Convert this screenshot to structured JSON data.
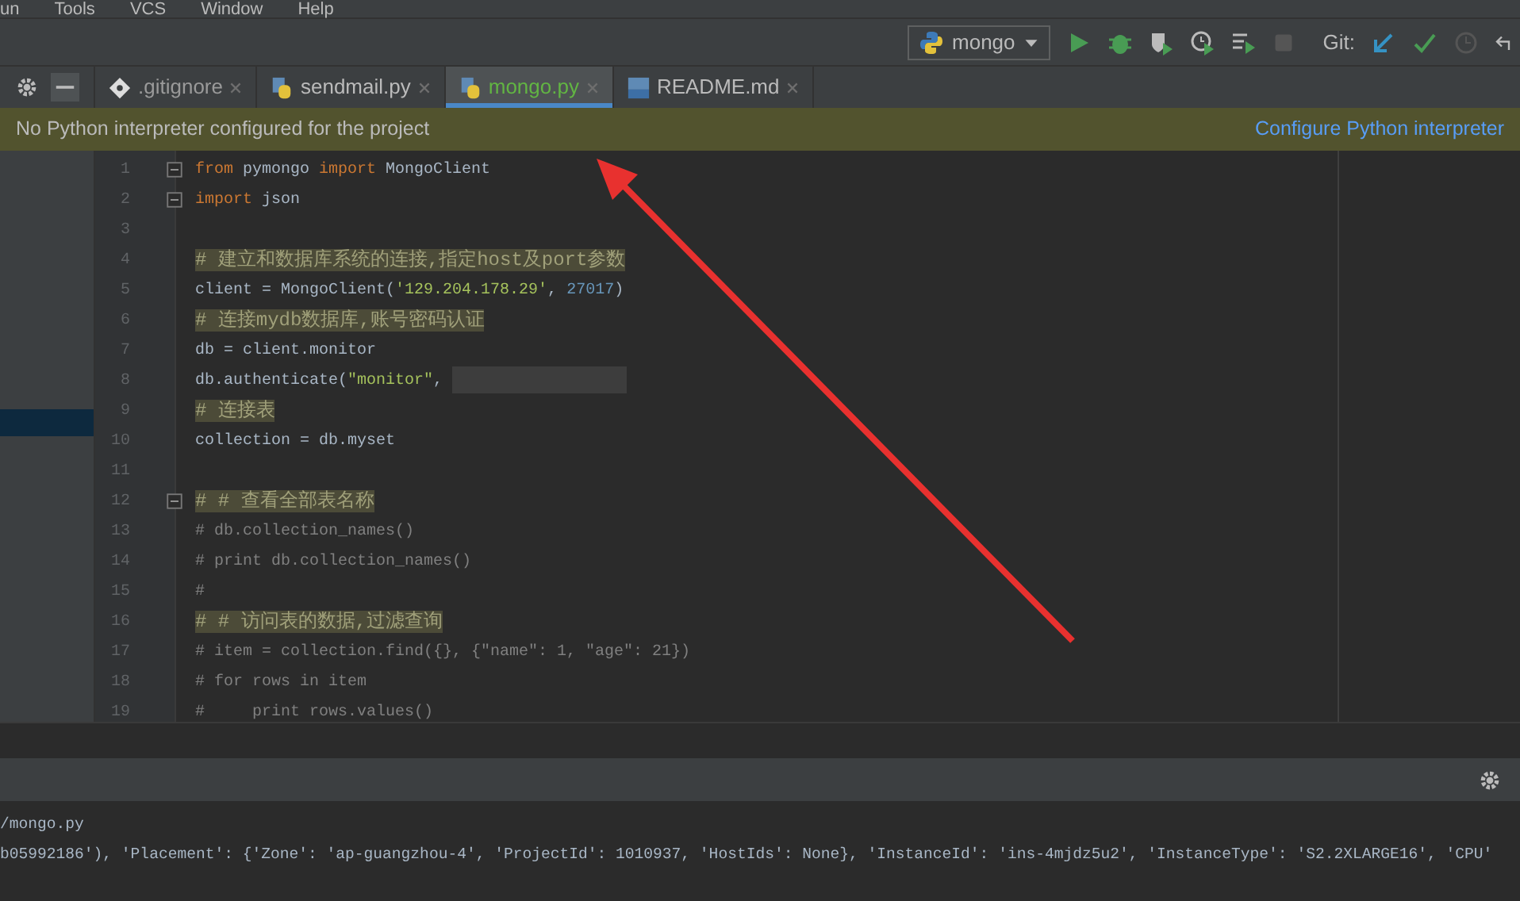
{
  "menu": [
    "un",
    "Tools",
    "VCS",
    "Window",
    "Help"
  ],
  "toolbar": {
    "run_config": "mongo",
    "stop_disabled": true,
    "git_label": "Git:"
  },
  "tabs": [
    {
      "label": ".gitignore",
      "kind": "git",
      "selected": false,
      "color": "#9a9a9a"
    },
    {
      "label": "sendmail.py",
      "kind": "python",
      "selected": false,
      "color": "#bbbbbb"
    },
    {
      "label": "mongo.py",
      "kind": "python",
      "selected": true,
      "color": "#62b543"
    },
    {
      "label": "README.md",
      "kind": "markdown",
      "selected": false,
      "color": "#bbbbbb"
    }
  ],
  "banner": {
    "message": "No Python interpreter configured for the project",
    "link": "Configure Python interpreter"
  },
  "editor": {
    "lines": [
      {
        "number": "1",
        "fold": true,
        "tokens": [
          {
            "kind": "keyword",
            "text": "from"
          },
          {
            "kind": "text",
            "text": " pymongo "
          },
          {
            "kind": "keyword",
            "text": "import"
          },
          {
            "kind": "text",
            "text": " MongoClient"
          }
        ]
      },
      {
        "number": "2",
        "fold": true,
        "tokens": [
          {
            "kind": "keyword",
            "text": "import"
          },
          {
            "kind": "text",
            "text": " json"
          }
        ]
      },
      {
        "number": "3",
        "fold": false
      },
      {
        "number": "4",
        "fold": false,
        "tokens": [
          {
            "kind": "note",
            "text": "# 建立和数据库系统的连接,指定host及port参数"
          }
        ]
      },
      {
        "number": "5",
        "fold": false,
        "tokens": [
          {
            "kind": "text",
            "text": "client = MongoClient("
          },
          {
            "kind": "string",
            "text": "'129.204.178.29'"
          },
          {
            "kind": "text",
            "text": ", "
          },
          {
            "kind": "number",
            "text": "27017"
          },
          {
            "kind": "text",
            "text": ")"
          }
        ]
      },
      {
        "number": "6",
        "fold": false,
        "tokens": [
          {
            "kind": "note",
            "text": "# 连接mydb数据库,账号密码认证"
          }
        ]
      },
      {
        "number": "7",
        "fold": false,
        "tokens": [
          {
            "kind": "text",
            "text": "db = client.monitor"
          }
        ]
      },
      {
        "number": "8",
        "fold": false,
        "tokens": [
          {
            "kind": "text",
            "text": "db.authenticate("
          },
          {
            "kind": "string",
            "text": "\"monitor\""
          },
          {
            "kind": "text",
            "text": ", "
          },
          {
            "kind": "redacted"
          }
        ]
      },
      {
        "number": "9",
        "fold": false,
        "tokens": [
          {
            "kind": "note",
            "text": "# 连接表"
          }
        ]
      },
      {
        "number": "10",
        "fold": false,
        "tokens": [
          {
            "kind": "text",
            "text": "collection = db.myset"
          }
        ]
      },
      {
        "number": "11",
        "fold": false
      },
      {
        "number": "12",
        "fold": true,
        "tokens": [
          {
            "kind": "note",
            "text": "# # 查看全部表名称"
          }
        ]
      },
      {
        "number": "13",
        "fold": false,
        "tokens": [
          {
            "kind": "comment",
            "text": "# db.collection_names()"
          }
        ]
      },
      {
        "number": "14",
        "fold": false,
        "tokens": [
          {
            "kind": "comment",
            "text": "# print db.collection_names()"
          }
        ]
      },
      {
        "number": "15",
        "fold": false,
        "tokens": [
          {
            "kind": "comment",
            "text": "#"
          }
        ]
      },
      {
        "number": "16",
        "fold": false,
        "tokens": [
          {
            "kind": "note",
            "text": "# # 访问表的数据,过滤查询"
          }
        ]
      },
      {
        "number": "17",
        "fold": false,
        "tokens": [
          {
            "kind": "comment",
            "text": "# item = collection.find({}, {\"name\": 1, \"age\": 21})"
          }
        ]
      },
      {
        "number": "18",
        "fold": false,
        "tokens": [
          {
            "kind": "comment",
            "text": "# for rows in item"
          }
        ]
      },
      {
        "number": "19",
        "fold": false,
        "tokens": [
          {
            "kind": "comment",
            "text": "#     print rows.values()"
          }
        ]
      }
    ]
  },
  "output": {
    "lines": [
      "/mongo.py",
      "b05992186'), 'Placement': {'Zone': 'ap-guangzhou-4', 'ProjectId': 1010937, 'HostIds': None}, 'InstanceId': 'ins-4mjdz5u2', 'InstanceType': 'S2.2XLARGE16', 'CPU'"
    ]
  }
}
